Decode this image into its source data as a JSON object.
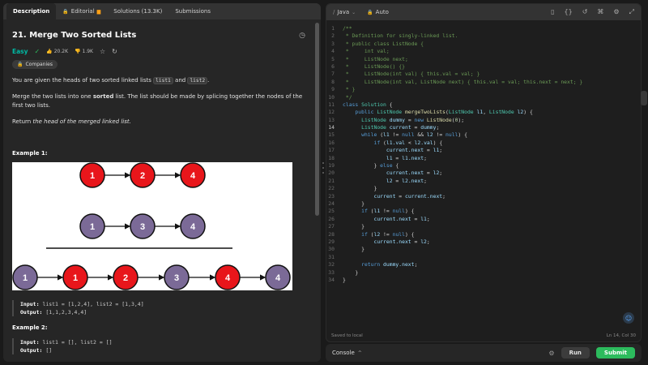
{
  "tabs": [
    {
      "label": "Description",
      "icon": "",
      "active": true
    },
    {
      "label": "Editorial",
      "icon": "lock-icon",
      "active": false
    },
    {
      "label": "Solutions (13.3K)",
      "icon": "",
      "active": false
    },
    {
      "label": "Submissions",
      "icon": "",
      "active": false
    }
  ],
  "problem": {
    "title": "21. Merge Two Sorted Lists",
    "difficulty": "Easy",
    "likes": "20.2K",
    "dislikes": "1.9K",
    "companies_label": "Companies",
    "para1_prefix": "You are given the heads of two sorted linked lists",
    "para1_code1": "list1",
    "para1_and": "and",
    "para1_code2": "list2",
    "para1_suffix": ".",
    "para2_prefix": "Merge the two lists into one",
    "para2_bold": "sorted",
    "para2_suffix": "list. The list should be made by splicing together the nodes of the first two lists.",
    "para3_prefix": "Return",
    "para3_italic": "the head of the merged linked list.",
    "example1_heading": "Example 1:",
    "example1_input_label": "Input:",
    "example1_input": "list1 = [1,2,4], list2 = [1,3,4]",
    "example1_output_label": "Output:",
    "example1_output": "[1,1,2,3,4,4]",
    "example2_heading": "Example 2:",
    "example2_input_label": "Input:",
    "example2_input": "list1 = [], list2 = []",
    "example2_output_label": "Output:",
    "example2_output": "[]"
  },
  "diagram": {
    "list1": [
      "1",
      "2",
      "4"
    ],
    "list2": [
      "1",
      "3",
      "4"
    ],
    "merged": [
      "1",
      "1",
      "2",
      "3",
      "4",
      "4"
    ],
    "merged_colors": [
      "purple",
      "red",
      "red",
      "purple",
      "red",
      "purple"
    ],
    "red_color": "#e8161b",
    "purple_color": "#7b6a97"
  },
  "editor": {
    "language": "Java",
    "mode": "Auto",
    "saved": "Saved to local",
    "position": "Ln 14, Col 30",
    "current_line": 14,
    "lines": [
      [
        {
          "c": "cm",
          "t": "/**"
        }
      ],
      [
        {
          "c": "cm",
          "t": " * Definition for singly-linked list."
        }
      ],
      [
        {
          "c": "cm",
          "t": " * public class ListNode {"
        }
      ],
      [
        {
          "c": "cm",
          "t": " *     int val;"
        }
      ],
      [
        {
          "c": "cm",
          "t": " *     ListNode next;"
        }
      ],
      [
        {
          "c": "cm",
          "t": " *     ListNode() {}"
        }
      ],
      [
        {
          "c": "cm",
          "t": " *     ListNode(int val) { this.val = val; }"
        }
      ],
      [
        {
          "c": "cm",
          "t": " *     ListNode(int val, ListNode next) { this.val = val; this.next = next; }"
        }
      ],
      [
        {
          "c": "cm",
          "t": " * }"
        }
      ],
      [
        {
          "c": "cm",
          "t": " */"
        }
      ],
      [
        {
          "c": "kw",
          "t": "class "
        },
        {
          "c": "ty",
          "t": "Solution"
        },
        {
          "c": "pl",
          "t": " {"
        }
      ],
      [
        {
          "c": "pl",
          "t": "    "
        },
        {
          "c": "kw",
          "t": "public "
        },
        {
          "c": "ty",
          "t": "ListNode "
        },
        {
          "c": "fn",
          "t": "mergeTwoLists"
        },
        {
          "c": "pl",
          "t": "("
        },
        {
          "c": "ty",
          "t": "ListNode "
        },
        {
          "c": "va",
          "t": "l1"
        },
        {
          "c": "pl",
          "t": ", "
        },
        {
          "c": "ty",
          "t": "ListNode "
        },
        {
          "c": "va",
          "t": "l2"
        },
        {
          "c": "pl",
          "t": ") {"
        }
      ],
      [
        {
          "c": "pl",
          "t": "      "
        },
        {
          "c": "ty",
          "t": "ListNode "
        },
        {
          "c": "va",
          "t": "dummy"
        },
        {
          "c": "pl",
          "t": " = "
        },
        {
          "c": "kw",
          "t": "new "
        },
        {
          "c": "fn",
          "t": "ListNode"
        },
        {
          "c": "pl",
          "t": "("
        },
        {
          "c": "nu",
          "t": "0"
        },
        {
          "c": "pl",
          "t": ");"
        }
      ],
      [
        {
          "c": "pl",
          "t": "      "
        },
        {
          "c": "ty",
          "t": "ListNode "
        },
        {
          "c": "va",
          "t": "current"
        },
        {
          "c": "pl",
          "t": " = "
        },
        {
          "c": "va",
          "t": "dummy"
        },
        {
          "c": "pl",
          "t": ";"
        }
      ],
      [
        {
          "c": "pl",
          "t": "      "
        },
        {
          "c": "kw",
          "t": "while "
        },
        {
          "c": "pl",
          "t": "("
        },
        {
          "c": "va",
          "t": "l1"
        },
        {
          "c": "pl",
          "t": " != "
        },
        {
          "c": "kw",
          "t": "null"
        },
        {
          "c": "pl",
          "t": " && "
        },
        {
          "c": "va",
          "t": "l2"
        },
        {
          "c": "pl",
          "t": " != "
        },
        {
          "c": "kw",
          "t": "null"
        },
        {
          "c": "pl",
          "t": ") {"
        }
      ],
      [
        {
          "c": "pl",
          "t": "          "
        },
        {
          "c": "kw",
          "t": "if "
        },
        {
          "c": "pl",
          "t": "("
        },
        {
          "c": "va",
          "t": "l1.val"
        },
        {
          "c": "pl",
          "t": " < "
        },
        {
          "c": "va",
          "t": "l2.val"
        },
        {
          "c": "pl",
          "t": ") {"
        }
      ],
      [
        {
          "c": "pl",
          "t": "              "
        },
        {
          "c": "va",
          "t": "current.next"
        },
        {
          "c": "pl",
          "t": " = "
        },
        {
          "c": "va",
          "t": "l1"
        },
        {
          "c": "pl",
          "t": ";"
        }
      ],
      [
        {
          "c": "pl",
          "t": "              "
        },
        {
          "c": "va",
          "t": "l1"
        },
        {
          "c": "pl",
          "t": " = "
        },
        {
          "c": "va",
          "t": "l1.next"
        },
        {
          "c": "pl",
          "t": ";"
        }
      ],
      [
        {
          "c": "pl",
          "t": "          } "
        },
        {
          "c": "kw",
          "t": "else"
        },
        {
          "c": "pl",
          "t": " {"
        }
      ],
      [
        {
          "c": "pl",
          "t": "              "
        },
        {
          "c": "va",
          "t": "current.next"
        },
        {
          "c": "pl",
          "t": " = "
        },
        {
          "c": "va",
          "t": "l2"
        },
        {
          "c": "pl",
          "t": ";"
        }
      ],
      [
        {
          "c": "pl",
          "t": "              "
        },
        {
          "c": "va",
          "t": "l2"
        },
        {
          "c": "pl",
          "t": " = "
        },
        {
          "c": "va",
          "t": "l2.next"
        },
        {
          "c": "pl",
          "t": ";"
        }
      ],
      [
        {
          "c": "pl",
          "t": "          }"
        }
      ],
      [
        {
          "c": "pl",
          "t": "          "
        },
        {
          "c": "va",
          "t": "current"
        },
        {
          "c": "pl",
          "t": " = "
        },
        {
          "c": "va",
          "t": "current.next"
        },
        {
          "c": "pl",
          "t": ";"
        }
      ],
      [
        {
          "c": "pl",
          "t": "      }"
        }
      ],
      [
        {
          "c": "pl",
          "t": "      "
        },
        {
          "c": "kw",
          "t": "if "
        },
        {
          "c": "pl",
          "t": "("
        },
        {
          "c": "va",
          "t": "l1"
        },
        {
          "c": "pl",
          "t": " != "
        },
        {
          "c": "kw",
          "t": "null"
        },
        {
          "c": "pl",
          "t": ") {"
        }
      ],
      [
        {
          "c": "pl",
          "t": "          "
        },
        {
          "c": "va",
          "t": "current.next"
        },
        {
          "c": "pl",
          "t": " = "
        },
        {
          "c": "va",
          "t": "l1"
        },
        {
          "c": "pl",
          "t": ";"
        }
      ],
      [
        {
          "c": "pl",
          "t": "      }"
        }
      ],
      [
        {
          "c": "pl",
          "t": "      "
        },
        {
          "c": "kw",
          "t": "if "
        },
        {
          "c": "pl",
          "t": "("
        },
        {
          "c": "va",
          "t": "l2"
        },
        {
          "c": "pl",
          "t": " != "
        },
        {
          "c": "kw",
          "t": "null"
        },
        {
          "c": "pl",
          "t": ") {"
        }
      ],
      [
        {
          "c": "pl",
          "t": "          "
        },
        {
          "c": "va",
          "t": "current.next"
        },
        {
          "c": "pl",
          "t": " = "
        },
        {
          "c": "va",
          "t": "l2"
        },
        {
          "c": "pl",
          "t": ";"
        }
      ],
      [
        {
          "c": "pl",
          "t": "      }"
        }
      ],
      [
        {
          "c": "pl",
          "t": ""
        }
      ],
      [
        {
          "c": "pl",
          "t": "      "
        },
        {
          "c": "kw",
          "t": "return "
        },
        {
          "c": "va",
          "t": "dummy.next"
        },
        {
          "c": "pl",
          "t": ";"
        }
      ],
      [
        {
          "c": "pl",
          "t": "    }"
        }
      ],
      [
        {
          "c": "pl",
          "t": "}"
        }
      ]
    ]
  },
  "bottom": {
    "console_label": "Console",
    "run_label": "Run",
    "submit_label": "Submit"
  }
}
